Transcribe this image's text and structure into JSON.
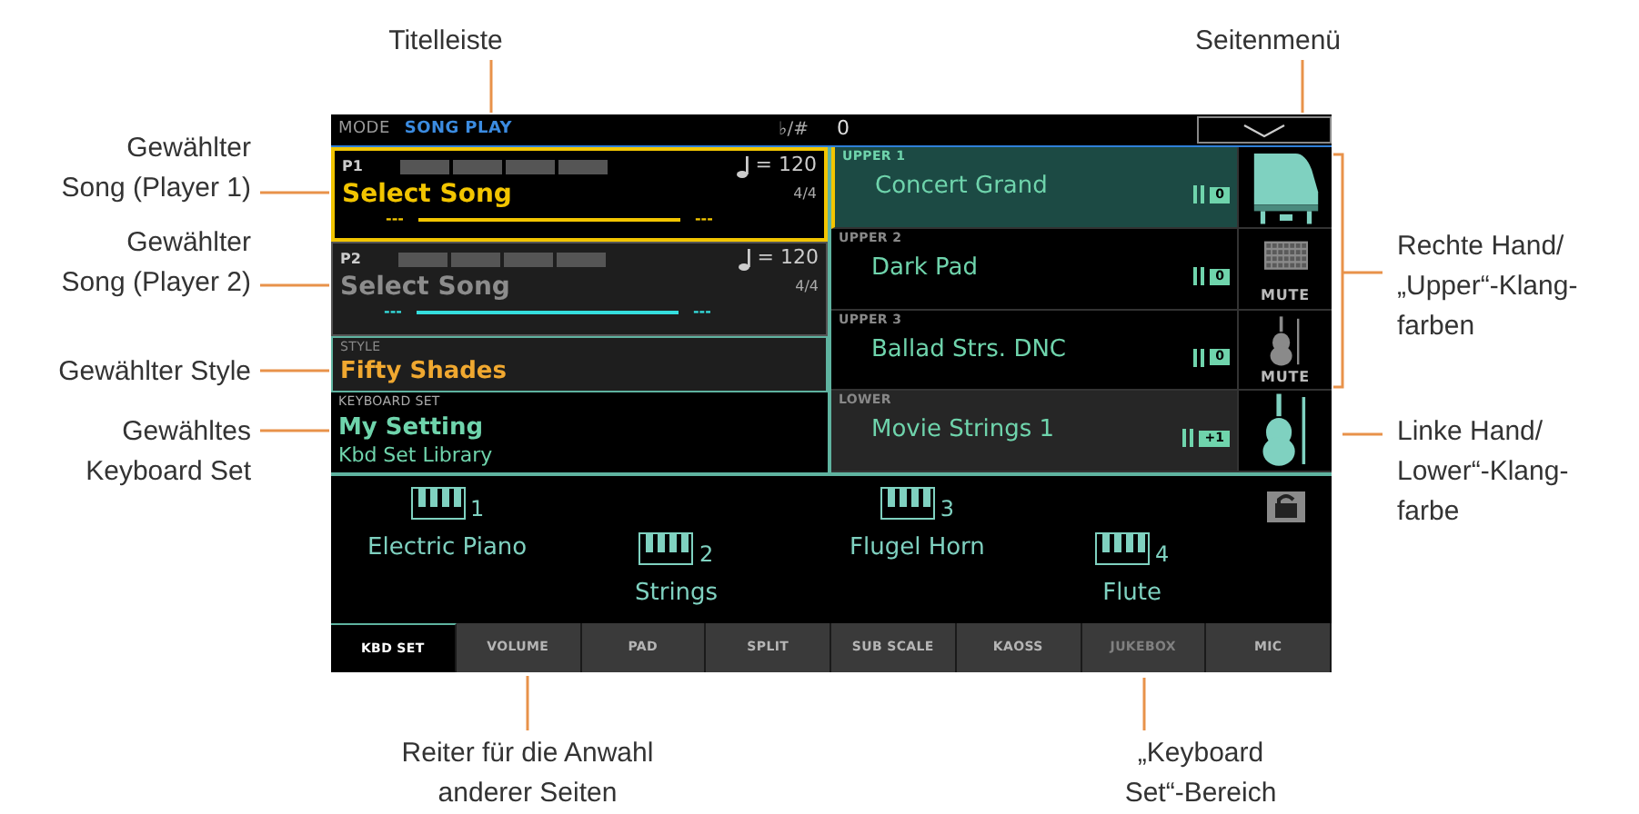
{
  "annotations": [
    {
      "text": "Titelleiste"
    },
    {
      "text": "Seitenmenü"
    },
    {
      "text": "Gewählter\nSong (Player 1)"
    },
    {
      "text": "Gewählter\nSong (Player 2)"
    },
    {
      "text": "Gewählter Style"
    },
    {
      "text": "Gewähltes\nKeyboard Set"
    },
    {
      "text": "Rechte Hand/\n„Upper“-Klang-\nfarben"
    },
    {
      "text": "Linke Hand/\nLower“-Klang-\nfarbe"
    },
    {
      "text": "Reiter für die Anwahl\nanderer Seiten"
    },
    {
      "text": "„Keyboard\nSet“-Bereich"
    }
  ],
  "header": {
    "mode_label": "MODE",
    "mode": "SONG PLAY",
    "transpose_label": "♭/#",
    "transpose": "0"
  },
  "players": [
    {
      "label": "P1",
      "song": "Select Song",
      "tempo": "= 120",
      "meter": "4/4",
      "start": "---",
      "end": "---",
      "selected": true,
      "color": "#f2c500"
    },
    {
      "label": "P2",
      "song": "Select Song",
      "tempo": "= 120",
      "meter": "4/4",
      "start": "---",
      "end": "---",
      "selected": false,
      "color": "#35dede"
    }
  ],
  "style": {
    "label": "STYLE",
    "name": "Fifty Shades"
  },
  "keyboard_set": {
    "label": "KEYBOARD SET",
    "name": "My Setting",
    "library": "Kbd Set Library"
  },
  "sounds": [
    {
      "label": "UPPER 1",
      "name": "Concert Grand",
      "octave": "0",
      "shaded": false,
      "selected": true,
      "kind": "piano"
    },
    {
      "label": "UPPER 2",
      "name": "Dark Pad",
      "octave": "0",
      "shaded": false,
      "selected": false,
      "kind": "pad",
      "mute_label": "MUTE"
    },
    {
      "label": "UPPER 3",
      "name": "Ballad Strs. DNC",
      "octave": "0",
      "shaded": false,
      "selected": false,
      "kind": "strings",
      "mute_label": "MUTE"
    },
    {
      "label": "LOWER",
      "name": "Movie Strings 1",
      "octave": "+1",
      "shaded": true,
      "selected": false,
      "kind": "strings"
    }
  ],
  "slots": [
    {
      "number": "1",
      "sound": "Electric Piano"
    },
    {
      "number": "2",
      "sound": "Strings"
    },
    {
      "number": "3",
      "sound": "Flugel Horn"
    },
    {
      "number": "4",
      "sound": "Flute"
    }
  ],
  "tabs": [
    {
      "label": "KBD SET",
      "selected": true,
      "disabled": false
    },
    {
      "label": "VOLUME",
      "selected": false,
      "disabled": false
    },
    {
      "label": "PAD",
      "selected": false,
      "disabled": false
    },
    {
      "label": "SPLIT",
      "selected": false,
      "disabled": false
    },
    {
      "label": "SUB SCALE",
      "selected": false,
      "disabled": false
    },
    {
      "label": "KAOSS",
      "selected": false,
      "disabled": false
    },
    {
      "label": "JUKEBOX",
      "selected": false,
      "disabled": true
    },
    {
      "label": "MIC",
      "selected": false,
      "disabled": false
    }
  ]
}
